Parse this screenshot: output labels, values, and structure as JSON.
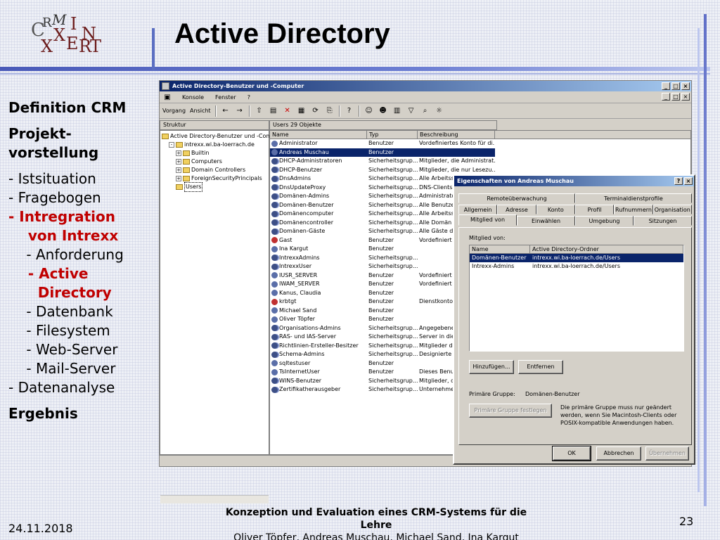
{
  "slide": {
    "title": "Active Directory",
    "logo": {
      "letters": [
        "C",
        "R",
        "M",
        "I",
        "N",
        "X",
        "T",
        "E",
        "R",
        "X"
      ]
    },
    "nav": [
      {
        "text": "Definition CRM",
        "style": "b"
      },
      {
        "text": "gap"
      },
      {
        "text": "Projekt-",
        "style": "b"
      },
      {
        "text": "vorstellung",
        "style": "b"
      },
      {
        "text": "gap"
      },
      {
        "text": "- Istsituation"
      },
      {
        "text": "- Fragebogen"
      },
      {
        "text": "- Intregration",
        "style": "red"
      },
      {
        "text": "    von Intrexx",
        "style": "red"
      },
      {
        "text": "    - Anforderung"
      },
      {
        "text": "    - Active",
        "style": "red"
      },
      {
        "text": "      Directory",
        "style": "red"
      },
      {
        "text": "    - Datenbank"
      },
      {
        "text": "    - Filesystem"
      },
      {
        "text": "    - Web-Server"
      },
      {
        "text": "    - Mail-Server"
      },
      {
        "text": "- Datenanalyse"
      },
      {
        "text": "gap"
      },
      {
        "text": "Ergebnis",
        "style": "b"
      }
    ],
    "footer_title": "Konzeption und Evaluation eines CRM-Systems für die Lehre",
    "footer_authors": "Oliver Töpfer, Andreas Muschau, Michael Sand, Ina Kargut",
    "date": "24.11.2018",
    "page_number": "23"
  },
  "mmc": {
    "title": "Active Directory-Benutzer und -Computer",
    "menu": [
      "Konsole",
      "Fenster",
      "?"
    ],
    "toolbar_menu": [
      "Vorgang",
      "Ansicht"
    ],
    "tree_tab": "Struktur",
    "tree": [
      {
        "label": "Active Directory-Benutzer und -Compu",
        "level": 0,
        "exp": ""
      },
      {
        "label": "intrexx.wi.ba-loerrach.de",
        "level": 1,
        "exp": "-"
      },
      {
        "label": "Builtin",
        "level": 2,
        "exp": "+"
      },
      {
        "label": "Computers",
        "level": 2,
        "exp": "+"
      },
      {
        "label": "Domain Controllers",
        "level": 2,
        "exp": "+"
      },
      {
        "label": "ForeignSecurityPrincipals",
        "level": 2,
        "exp": "+"
      },
      {
        "label": "Users",
        "level": 2,
        "exp": ""
      }
    ],
    "list_header": "Users   29 Objekte",
    "columns": [
      "Name",
      "Typ",
      "Beschreibung"
    ],
    "rows": [
      {
        "name": "Administrator",
        "type": "Benutzer",
        "desc": "Vordefiniertes Konto für di...",
        "icon": "user"
      },
      {
        "name": "Andreas Muschau",
        "type": "Benutzer",
        "desc": "",
        "icon": "user",
        "selected": true
      },
      {
        "name": "DHCP-Administratoren",
        "type": "Sicherheitsgrup...",
        "desc": "Mitglieder, die Administrat...",
        "icon": "grp"
      },
      {
        "name": "DHCP-Benutzer",
        "type": "Sicherheitsgrup...",
        "desc": "Mitglieder, die nur Lesezu...",
        "icon": "grp"
      },
      {
        "name": "DnsAdmins",
        "type": "Sicherheitsgrup...",
        "desc": "Alle Arbeitss",
        "icon": "grp"
      },
      {
        "name": "DnsUpdateProxy",
        "type": "Sicherheitsgrup...",
        "desc": "DNS-Clients,",
        "icon": "grp"
      },
      {
        "name": "Domänen-Admins",
        "type": "Sicherheitsgrup...",
        "desc": "Administrato",
        "icon": "grp"
      },
      {
        "name": "Domänen-Benutzer",
        "type": "Sicherheitsgrup...",
        "desc": "Alle Benutze",
        "icon": "grp"
      },
      {
        "name": "Domänencomputer",
        "type": "Sicherheitsgrup...",
        "desc": "Alle Arbeitss",
        "icon": "grp"
      },
      {
        "name": "Domänencontroller",
        "type": "Sicherheitsgrup...",
        "desc": "Alle Domän",
        "icon": "grp"
      },
      {
        "name": "Domänen-Gäste",
        "type": "Sicherheitsgrup...",
        "desc": "Alle Gäste de",
        "icon": "grp"
      },
      {
        "name": "Gast",
        "type": "Benutzer",
        "desc": "Vordefiniert",
        "icon": "dis"
      },
      {
        "name": "Ina Kargut",
        "type": "Benutzer",
        "desc": "",
        "icon": "user"
      },
      {
        "name": "IntrexxAdmins",
        "type": "Sicherheitsgrup...",
        "desc": "",
        "icon": "grp"
      },
      {
        "name": "IntrexxUser",
        "type": "Sicherheitsgrup...",
        "desc": "",
        "icon": "grp"
      },
      {
        "name": "IUSR_SERVER",
        "type": "Benutzer",
        "desc": "Vordefiniert",
        "icon": "user"
      },
      {
        "name": "IWAM_SERVER",
        "type": "Benutzer",
        "desc": "Vordefiniert",
        "icon": "user"
      },
      {
        "name": "Kanus, Claudia",
        "type": "Benutzer",
        "desc": "",
        "icon": "user"
      },
      {
        "name": "krbtgt",
        "type": "Benutzer",
        "desc": "Dienstkonto",
        "icon": "dis"
      },
      {
        "name": "Michael Sand",
        "type": "Benutzer",
        "desc": "",
        "icon": "user"
      },
      {
        "name": "Oliver Töpfer",
        "type": "Benutzer",
        "desc": "",
        "icon": "user"
      },
      {
        "name": "Organisations-Admins",
        "type": "Sicherheitsgrup...",
        "desc": "Angegebene",
        "icon": "grp"
      },
      {
        "name": "RAS- und IAS-Server",
        "type": "Sicherheitsgrup...",
        "desc": "Server in die",
        "icon": "grp"
      },
      {
        "name": "Richtlinien-Ersteller-Besitzer",
        "type": "Sicherheitsgrup...",
        "desc": "Mitglieder di",
        "icon": "grp"
      },
      {
        "name": "Schema-Admins",
        "type": "Sicherheitsgrup...",
        "desc": "Designierte",
        "icon": "grp"
      },
      {
        "name": "sqltestuser",
        "type": "Benutzer",
        "desc": "",
        "icon": "user"
      },
      {
        "name": "TsInternetUser",
        "type": "Benutzer",
        "desc": "Dieses Benut",
        "icon": "user"
      },
      {
        "name": "WINS-Benutzer",
        "type": "Sicherheitsgrup...",
        "desc": "Mitglieder, die",
        "icon": "grp"
      },
      {
        "name": "Zertifikatherausgeber",
        "type": "Sicherheitsgrup...",
        "desc": "Unternehmen",
        "icon": "grp"
      }
    ]
  },
  "dialog": {
    "title": "Eigenschaften von Andreas Muschau",
    "tabs_row1": [
      "Remoteüberwachung",
      "Terminaldienstprofile"
    ],
    "tabs_row2": [
      "Allgemein",
      "Adresse",
      "Konto",
      "Profil",
      "Rufnummern",
      "Organisation"
    ],
    "tabs_row3": [
      "Mitglied von",
      "Einwählen",
      "Umgebung",
      "Sitzungen"
    ],
    "member_of_label": "Mitglied von:",
    "columns": [
      "Name",
      "Active Directory-Ordner"
    ],
    "rows": [
      {
        "name": "Domänen-Benutzer",
        "folder": "intrexx.wi.ba-loerrach.de/Users",
        "selected": true
      },
      {
        "name": "Intrexx-Admins",
        "folder": "intrexx.wi.ba-loerrach.de/Users"
      }
    ],
    "add_button": "Hinzufügen...",
    "remove_button": "Entfernen",
    "primary_group_label": "Primäre Gruppe:",
    "primary_group_value": "Domänen-Benutzer",
    "set_primary_button": "Primäre Gruppe festlegen",
    "info_text": "Die primäre Gruppe muss nur geändert werden, wenn Sie Macintosh-Clients oder POSIX-kompatible Anwendungen haben.",
    "ok_button": "OK",
    "cancel_button": "Abbrechen",
    "apply_button": "Übernehmen"
  }
}
